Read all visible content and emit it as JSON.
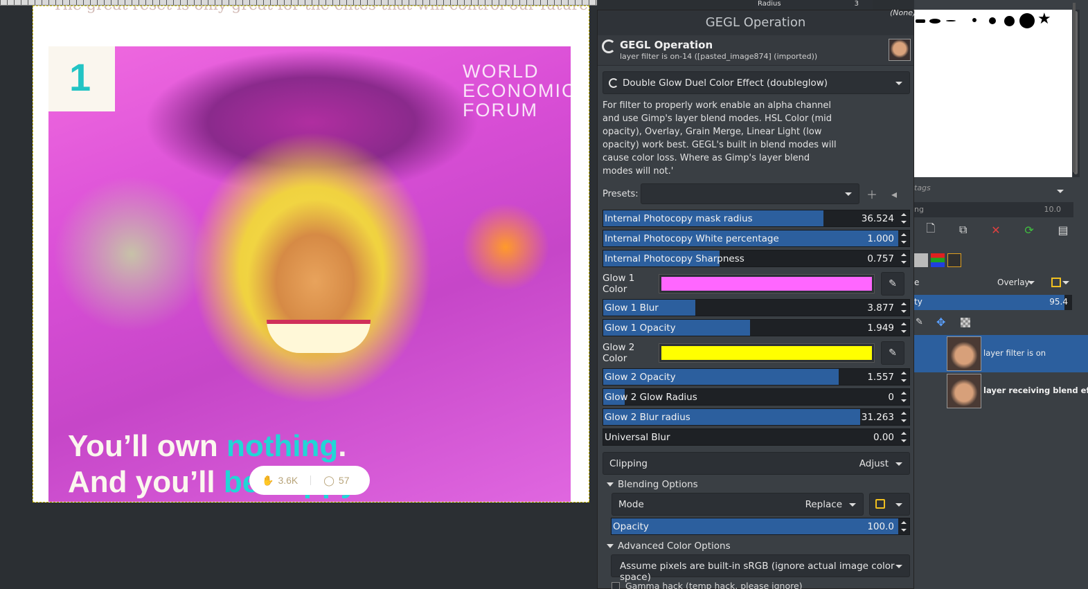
{
  "canvas": {
    "top_text": "The great reset is only great for the elites that will control our future",
    "photo_number": "1",
    "wef_logo": [
      "WORLD",
      "ECONOMIC",
      "FORUM"
    ],
    "tagline_line1_a": "You’ll own ",
    "tagline_line1_b": "nothing",
    "tagline_line1_c": ".",
    "tagline_line2_a": "And you’ll ",
    "tagline_line2_b": "be happy",
    "claps": "3.6K",
    "comments": "57"
  },
  "dialog": {
    "title": "GEGL Operation",
    "header_title": "GEGL Operation",
    "header_subtitle": "layer filter is on-14 ([pasted_image874] (imported))",
    "operation": "Double Glow Duel Color Effect (doubleglow)",
    "description": "For filter to properly work enable an alpha channel and use Gimp's layer blend modes. HSL Color (mid opacity),  Overlay, Grain Merge, Linear Light (low opacity) work best. GEGL's built in blend modes will cause color loss. Where as Gimp's layer blend modes will not.'",
    "presets_label": "Presets:",
    "sliders": [
      {
        "label": "Internal Photocopy mask radius",
        "value": "36.524",
        "fill": 0.72
      },
      {
        "label": "Internal Photocopy White percentage",
        "value": "1.000",
        "fill": 1.0
      },
      {
        "label": "Internal Photocopy Sharpness",
        "value": "0.757",
        "fill": 0.38
      }
    ],
    "glow1_color_label": "Glow 1 Color",
    "glow1_color": "#ff66ff",
    "glow1_sliders": [
      {
        "label": "Glow 1 Blur",
        "value": "3.877",
        "fill": 0.3
      },
      {
        "label": "Glow 1 Opacity",
        "value": "1.949",
        "fill": 0.48
      }
    ],
    "glow2_color_label": "Glow 2 Color",
    "glow2_color": "#ffff00",
    "glow2_sliders": [
      {
        "label": "Glow 2 Opacity",
        "value": "1.557",
        "fill": 0.77
      },
      {
        "label": "Glow 2 Glow Radius",
        "value": "0",
        "fill": 0.07
      },
      {
        "label": "Glow 2 Blur radius",
        "value": "31.263",
        "fill": 0.84
      },
      {
        "label": "Universal Blur",
        "value": "0.00",
        "fill": 0.0
      }
    ],
    "clipping_label": "Clipping",
    "clipping_value": "Adjust",
    "blending_options": "Blending Options",
    "mode_label": "Mode",
    "mode_value": "Replace",
    "opacity_label": "Opacity",
    "opacity_value": "100.0",
    "opacity_fill": 1.0,
    "advanced_color": "Advanced Color Options",
    "assume_pixels": "Assume pixels are built-in sRGB (ignore actual image color space)",
    "gamma_hack": "Gamma hack (temp hack, please ignore)"
  },
  "dock": {
    "top_field": "Radius",
    "top_field_value": "3",
    "brush_none": "(None)",
    "tags_placeholder": "tags",
    "spacing_label": "ng",
    "spacing_value": "10.0",
    "layer_mode_label": "e",
    "layer_mode_value": "Overlay",
    "layer_opacity_label": "ty",
    "layer_opacity_value": "95.4",
    "layers": [
      {
        "name": "layer filter is on",
        "selected": true
      },
      {
        "name": "layer receiving blend effect",
        "selected": false
      }
    ]
  }
}
